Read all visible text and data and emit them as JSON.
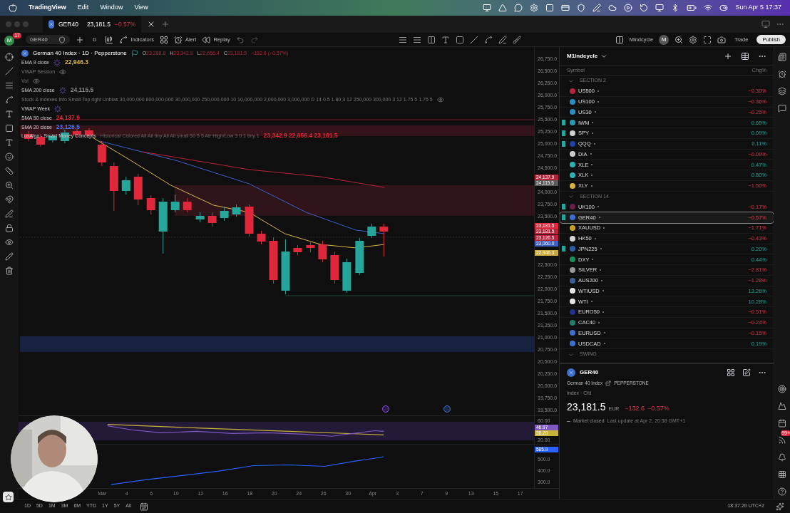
{
  "menu_bar": {
    "app": "TradingView",
    "items": [
      "Edit",
      "Window",
      "View"
    ],
    "clock": "Sun Apr 5  17:37"
  },
  "tab": {
    "symbol": "GER40",
    "price": "23,181.5",
    "change": "−0.57%",
    "down": true
  },
  "toolbar": {
    "avatar": "M",
    "badge": "17",
    "symbol": "GER40",
    "interval": "D",
    "indicators": "Indicators",
    "alert": "Alert",
    "replay": "Replay",
    "layout": "Mindcycle",
    "layout_avatar": "M",
    "trade": "Trade",
    "publish": "Publish"
  },
  "legend": {
    "title": "German 40 Index · 1D · Pepperstone",
    "ohlc": [
      {
        "key": "O",
        "value": "23,288.8"
      },
      {
        "key": "H",
        "value": "23,342.9"
      },
      {
        "key": "L",
        "value": "22,656.4"
      },
      {
        "key": "C",
        "value": "23,181.5"
      }
    ],
    "change": "−132.6 (−0.57%)",
    "indicators": [
      {
        "name": "EMA 9 close",
        "value": "22,946.3",
        "color": "#d9b84a",
        "hidden": false,
        "loading": true
      },
      {
        "name": "VWAP Session",
        "hidden": true,
        "loading": false
      },
      {
        "name": "Vol",
        "hidden": true,
        "loading": false
      },
      {
        "name": "SMA 200 close",
        "value": "24,115.5",
        "color": "#8a8a8a",
        "hidden": false,
        "loading": true
      },
      {
        "name": "Stock & indexes Info Small Top right Unbias 30,000,000 800,000,000 30,000,000 250,000,000 10 10,000,000 2,000,000 3,000,000 D 14 0.5 1.80 3 12 250,000 300,000 3 12 1.75 5 1.75 5",
        "hidden": true,
        "loading": false
      },
      {
        "name": "VWAP Week",
        "hidden": false,
        "loading": true
      },
      {
        "name": "SMA 50 close",
        "value": "24,137.9",
        "color": "#e0283c",
        "hidden": false,
        "loading": false
      },
      {
        "name": "SMA 20 close",
        "value": "23,126.5",
        "color": "#4a72e8",
        "hidden": false,
        "loading": false
      },
      {
        "name": "LuxAlgo - Smart Money Concepts",
        "params": "Historical Colored All All tiny All All small 50 5 5 Atr High/Low 3 0.1 tiny 1",
        "value": "23,342.9  22,656.4  23,181.5",
        "color": "#e0283c",
        "hidden": false,
        "loading": false
      }
    ]
  },
  "price_axis": [
    {
      "kind": "label",
      "text": "26,750.0"
    },
    {
      "kind": "label",
      "text": "26,500.0"
    },
    {
      "kind": "label",
      "text": "26,250.0"
    },
    {
      "kind": "label",
      "text": "26,000.0"
    },
    {
      "kind": "label",
      "text": "25,750.0"
    },
    {
      "kind": "label",
      "text": "25,500.0"
    },
    {
      "kind": "label",
      "text": "25,250.0"
    },
    {
      "kind": "label",
      "text": "25,000.0"
    },
    {
      "kind": "label",
      "text": "24,750.0"
    },
    {
      "kind": "label",
      "text": "24,500.0"
    },
    {
      "kind": "tags",
      "tags": [
        {
          "text": "24,137.9",
          "color": "#b8233a"
        },
        {
          "text": "24,115.5",
          "color": "#5a5a5a"
        }
      ]
    },
    {
      "kind": "label",
      "text": "24,000.0"
    },
    {
      "kind": "label",
      "text": "23,750.0"
    },
    {
      "kind": "label",
      "text": "23,500.0"
    },
    {
      "kind": "tags",
      "tags": [
        {
          "text": "23,181.5",
          "color": "#e0283c"
        },
        {
          "text": "23,181.5",
          "color": "#b8233a"
        }
      ]
    },
    {
      "kind": "tags",
      "tags": [
        {
          "text": "23,126.5",
          "color": "#b8233a"
        },
        {
          "text": "23,060.0",
          "color": "#3d5fc4"
        }
      ]
    },
    {
      "kind": "tags",
      "tags": [
        {
          "text": "22,946.3",
          "color": "#c9a93a"
        }
      ]
    },
    {
      "kind": "label",
      "text": "22,500.0"
    },
    {
      "kind": "label",
      "text": "22,250.0"
    },
    {
      "kind": "label",
      "text": "22,000.0"
    },
    {
      "kind": "label",
      "text": "21,750.0"
    },
    {
      "kind": "label",
      "text": "21,500.0"
    },
    {
      "kind": "label",
      "text": "21,250.0"
    },
    {
      "kind": "label",
      "text": "21,000.0"
    },
    {
      "kind": "label",
      "text": "20,750.0"
    },
    {
      "kind": "label",
      "text": "20,500.0"
    },
    {
      "kind": "label",
      "text": "20,250.0"
    },
    {
      "kind": "label",
      "text": "20,000.0"
    },
    {
      "kind": "label",
      "text": "19,750.0"
    },
    {
      "kind": "label",
      "text": "19,500.0"
    }
  ],
  "rsi_pane": {
    "axis": [
      {
        "kind": "label",
        "text": "60.00"
      },
      {
        "kind": "tags",
        "tags": [
          {
            "text": "46.97",
            "color": "#7e57c2"
          },
          {
            "text": "38.20",
            "color": "#c9b23a"
          }
        ]
      },
      {
        "kind": "label",
        "text": "20.00"
      }
    ]
  },
  "volume_pane": {
    "axis": [
      {
        "kind": "tags",
        "tags": [
          {
            "text": "585.9",
            "color": "#2962ff"
          }
        ]
      },
      {
        "kind": "label",
        "text": "500.0"
      },
      {
        "kind": "label",
        "text": "400.0"
      },
      {
        "kind": "label",
        "text": "300.0"
      }
    ]
  },
  "time_axis": [
    "Mar",
    "4",
    "6",
    "10",
    "12",
    "16",
    "18",
    "20",
    "24",
    "26",
    "30",
    "Apr",
    "3",
    "7",
    "9",
    "13",
    "15",
    "17"
  ],
  "bottom_bar": {
    "ranges": [
      "1D",
      "5D",
      "1M",
      "3M",
      "6M",
      "YTD",
      "1Y",
      "5Y",
      "All"
    ],
    "clock": "18:37:20 UTC+2"
  },
  "watchlist": {
    "name": "M1indcycle",
    "columns": [
      "Symbol",
      "Chg%"
    ],
    "sections": [
      {
        "title": "SECTION 2",
        "rows": [
          {
            "symbol": "US500",
            "change": "−0.30%",
            "down": true,
            "color": "#b8233a",
            "flagged": false,
            "selected": false
          },
          {
            "symbol": "US100",
            "change": "−0.36%",
            "down": true,
            "color": "#2a8fc4",
            "flagged": false,
            "selected": false
          },
          {
            "symbol": "US30",
            "change": "−0.25%",
            "down": true,
            "color": "#2a8fc4",
            "flagged": false,
            "selected": false
          },
          {
            "symbol": "IWM",
            "change": "0.69%",
            "down": false,
            "color": "#2a9bb5",
            "flagged": true,
            "selected": false
          },
          {
            "symbol": "SPY",
            "change": "0.09%",
            "down": false,
            "color": "#d0d0d0",
            "flagged": true,
            "selected": false
          },
          {
            "symbol": "QQQ",
            "change": "0.11%",
            "down": false,
            "color": "#1c3fa8",
            "flagged": true,
            "selected": false
          },
          {
            "symbol": "DIA",
            "change": "−0.09%",
            "down": true,
            "color": "#d0d0d0",
            "flagged": false,
            "selected": false
          },
          {
            "symbol": "XLE",
            "change": "0.47%",
            "down": false,
            "color": "#2ab0b5",
            "flagged": false,
            "selected": false
          },
          {
            "symbol": "XLK",
            "change": "0.80%",
            "down": false,
            "color": "#2ab0b5",
            "flagged": false,
            "selected": false
          },
          {
            "symbol": "XLY",
            "change": "−1.50%",
            "down": true,
            "color": "#d8b13a",
            "flagged": false,
            "selected": false
          }
        ]
      },
      {
        "title": "SECTION 14",
        "rows": [
          {
            "symbol": "UK100",
            "change": "−0.17%",
            "down": true,
            "color": "#6b1d4a",
            "flagged": true,
            "selected": false
          },
          {
            "symbol": "GER40",
            "change": "−0.57%",
            "down": true,
            "color": "#3d6fd1",
            "flagged": true,
            "selected": true
          },
          {
            "symbol": "XAUUSD",
            "change": "−1.71%",
            "down": true,
            "color": "#c9a02a",
            "flagged": false,
            "selected": false
          },
          {
            "symbol": "HK50",
            "change": "−0.43%",
            "down": true,
            "color": "#d6d6d6",
            "flagged": false,
            "selected": false
          },
          {
            "symbol": "JPN225",
            "change": "0.20%",
            "down": false,
            "color": "#2a5fa8",
            "flagged": true,
            "selected": false
          },
          {
            "symbol": "DXY",
            "change": "0.44%",
            "down": false,
            "color": "#1f8f5a",
            "flagged": false,
            "selected": false
          },
          {
            "symbol": "SILVER",
            "change": "−2.81%",
            "down": true,
            "color": "#9a9a9a",
            "flagged": false,
            "selected": false
          },
          {
            "symbol": "AUS200",
            "change": "−1.28%",
            "down": true,
            "color": "#3a5f9a",
            "flagged": false,
            "selected": false
          },
          {
            "symbol": "WTIUSD",
            "change": "13.26%",
            "down": false,
            "color": "#e8e8e8",
            "flagged": false,
            "selected": false
          },
          {
            "symbol": "WTI",
            "change": "10.28%",
            "down": false,
            "color": "#e8e8e8",
            "flagged": false,
            "selected": false
          },
          {
            "symbol": "EURO50",
            "change": "−0.51%",
            "down": true,
            "color": "#22308f",
            "flagged": false,
            "selected": false
          },
          {
            "symbol": "CAC40",
            "change": "−0.24%",
            "down": true,
            "color": "#1f7f6a",
            "flagged": false,
            "selected": false
          },
          {
            "symbol": "EURUSD",
            "change": "−0.15%",
            "down": true,
            "color": "#3d6fd1",
            "flagged": false,
            "selected": false
          },
          {
            "symbol": "USDCAD",
            "change": "0.19%",
            "down": false,
            "color": "#3d6fd1",
            "flagged": false,
            "selected": false
          }
        ]
      },
      {
        "title": "SWING"
      }
    ]
  },
  "details": {
    "symbol": "GER40",
    "name": "German 40 Index",
    "exchange": "PEPPERSTONE",
    "type": "Index · Cfd",
    "price": "23,181.5",
    "currency": "EUR",
    "change": "−132.6",
    "change_pct": "−0.57%",
    "down": true,
    "status": "Market closed",
    "updated": "Last update at Apr 2, 20:58 GMT+1"
  },
  "notifications_badge": "99+"
}
